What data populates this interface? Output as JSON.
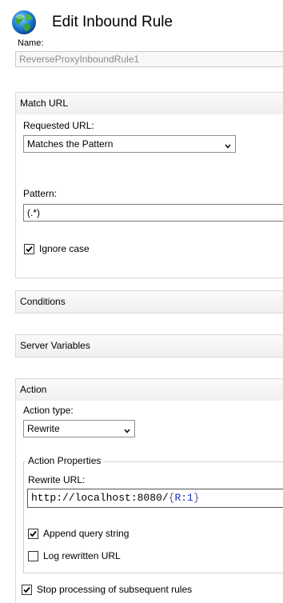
{
  "header": {
    "title": "Edit Inbound Rule"
  },
  "name_field": {
    "label": "Name:",
    "value": "ReverseProxyInboundRule1"
  },
  "match_url": {
    "title": "Match URL",
    "requested_url_label": "Requested URL:",
    "requested_url_value": "Matches the Pattern",
    "pattern_label": "Pattern:",
    "pattern_value": "(.*)",
    "ignore_case_label": "Ignore case",
    "ignore_case_checked": true
  },
  "conditions": {
    "title": "Conditions"
  },
  "server_variables": {
    "title": "Server Variables"
  },
  "action": {
    "title": "Action",
    "action_type_label": "Action type:",
    "action_type_value": "Rewrite",
    "properties_legend": "Action Properties",
    "rewrite_url_label": "Rewrite URL:",
    "rewrite_url_prefix": "http://localhost:8080/",
    "rewrite_url_open": "{",
    "rewrite_url_var": "R:1",
    "rewrite_url_close": "}",
    "append_query_label": "Append query string",
    "append_query_checked": true,
    "log_rewritten_label": "Log rewritten URL",
    "log_rewritten_checked": false,
    "stop_processing_label": "Stop processing of subsequent rules",
    "stop_processing_checked": true
  },
  "icons": [
    "globe-icon",
    "chevron-down-icon",
    "checkmark-icon"
  ]
}
